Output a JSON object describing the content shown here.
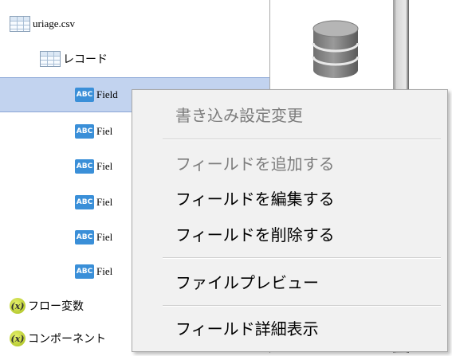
{
  "tree": {
    "items": [
      {
        "label": "uriage.csv",
        "icon": "csv-file-grid-icon"
      },
      {
        "label": "レコード",
        "icon": "record-grid-icon"
      },
      {
        "label": "Field",
        "icon": "abc-field-icon"
      },
      {
        "label": "Fiel",
        "icon": "abc-field-icon"
      },
      {
        "label": "Fiel",
        "icon": "abc-field-icon"
      },
      {
        "label": "Fiel",
        "icon": "abc-field-icon"
      },
      {
        "label": "Fiel",
        "icon": "abc-field-icon"
      },
      {
        "label": "Fiel",
        "icon": "abc-field-icon"
      },
      {
        "label": "フロー変数",
        "icon": "variable-x-icon"
      },
      {
        "label": "コンポーネント",
        "icon": "variable-x-icon"
      }
    ],
    "abc_text": "ABC",
    "x_text": "(x)",
    "selected_index": 2
  },
  "right_panel": {
    "icon": "database-icon"
  },
  "context_menu": {
    "items": [
      {
        "label": "書き込み設定変更",
        "enabled": false
      },
      {
        "label": "フィールドを追加する",
        "enabled": false
      },
      {
        "label": "フィールドを編集する",
        "enabled": true
      },
      {
        "label": "フィールドを削除する",
        "enabled": true
      },
      {
        "label": "ファイルプレビュー",
        "enabled": true
      },
      {
        "label": "フィールド詳細表示",
        "enabled": true
      }
    ]
  },
  "colors": {
    "selection": "#c2d3ef",
    "abc_icon": "#3a8fd8",
    "x_icon": "#c4d62e",
    "menu_bg": "#f1f1f1",
    "disabled_text": "#7d7d7d"
  }
}
